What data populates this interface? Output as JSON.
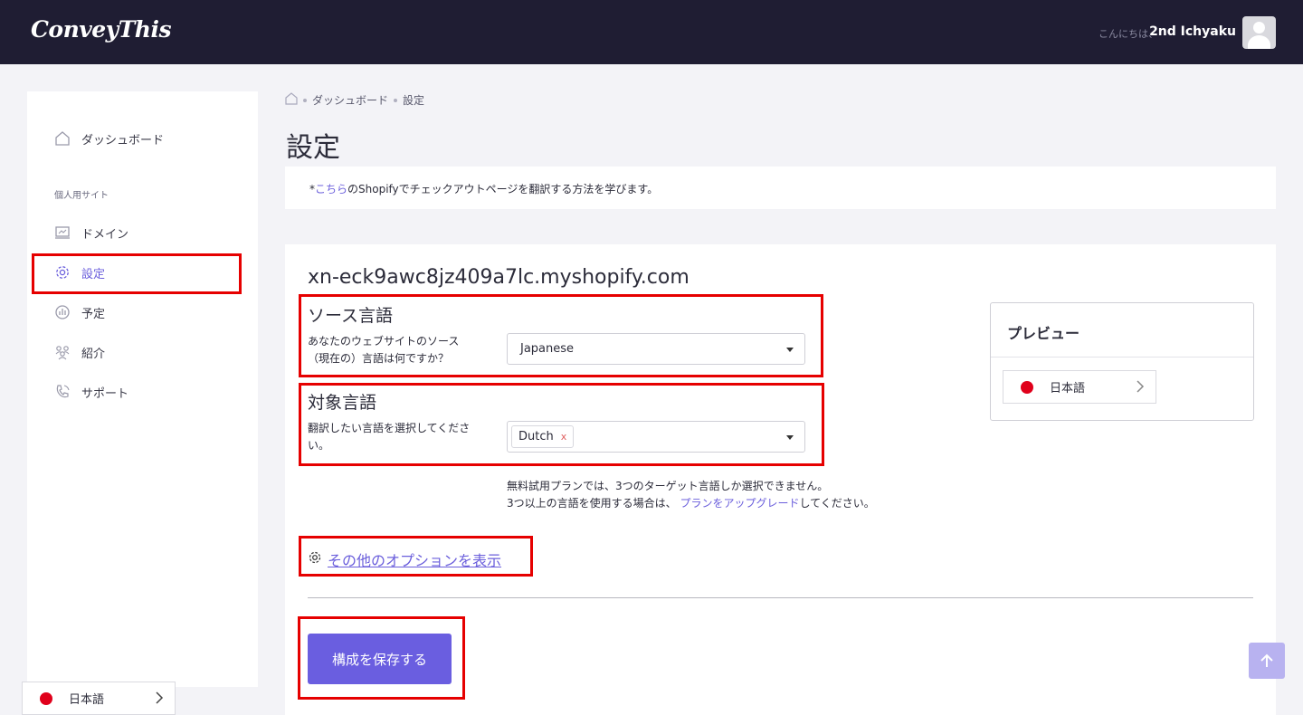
{
  "header": {
    "logo": "ConveyThis",
    "greeting": "こんにちは、",
    "username": "2nd Ichyaku"
  },
  "sidebar": {
    "dashboard": "ダッシュボード",
    "section_label": "個人用サイト",
    "items": [
      {
        "label": "ドメイン",
        "icon": "monitor-icon"
      },
      {
        "label": "設定",
        "icon": "gear-icon",
        "active": true
      },
      {
        "label": "予定",
        "icon": "chart-icon"
      },
      {
        "label": "紹介",
        "icon": "users-icon"
      },
      {
        "label": "サポート",
        "icon": "phone-icon"
      }
    ],
    "language": "日本語"
  },
  "breadcrumb": [
    "ダッシュボード",
    "設定"
  ],
  "page_title": "設定",
  "notice": {
    "prefix": "*",
    "link": "こちら",
    "text": "のShopifyでチェックアウトページを翻訳する方法を学びます。"
  },
  "card": {
    "domain": "xn-eck9awc8jz409a7lc.myshopify.com",
    "source": {
      "title": "ソース言語",
      "label": "あなたのウェブサイトのソース（現在の）言語は何ですか？",
      "value": "Japanese"
    },
    "target": {
      "title": "対象言語",
      "label": "翻訳したい言語を選択してください。",
      "tag": "Dutch",
      "tag_remove": "x"
    },
    "info_line1": "無料試用プランでは、3つのターゲット言語しか選択できません。",
    "info_line2_prefix": "3つ以上の言語を使用する場合は、",
    "info_link": "プランをアップグレード",
    "info_line2_suffix": "してください。",
    "more_options": "その他のオプションを表示",
    "save_button": "構成を保存する"
  },
  "preview": {
    "title": "プレビュー",
    "language": "日本語"
  },
  "colors": {
    "accent": "#6a5ee0",
    "topbar": "#1f1d33",
    "highlight": "#e60000"
  }
}
